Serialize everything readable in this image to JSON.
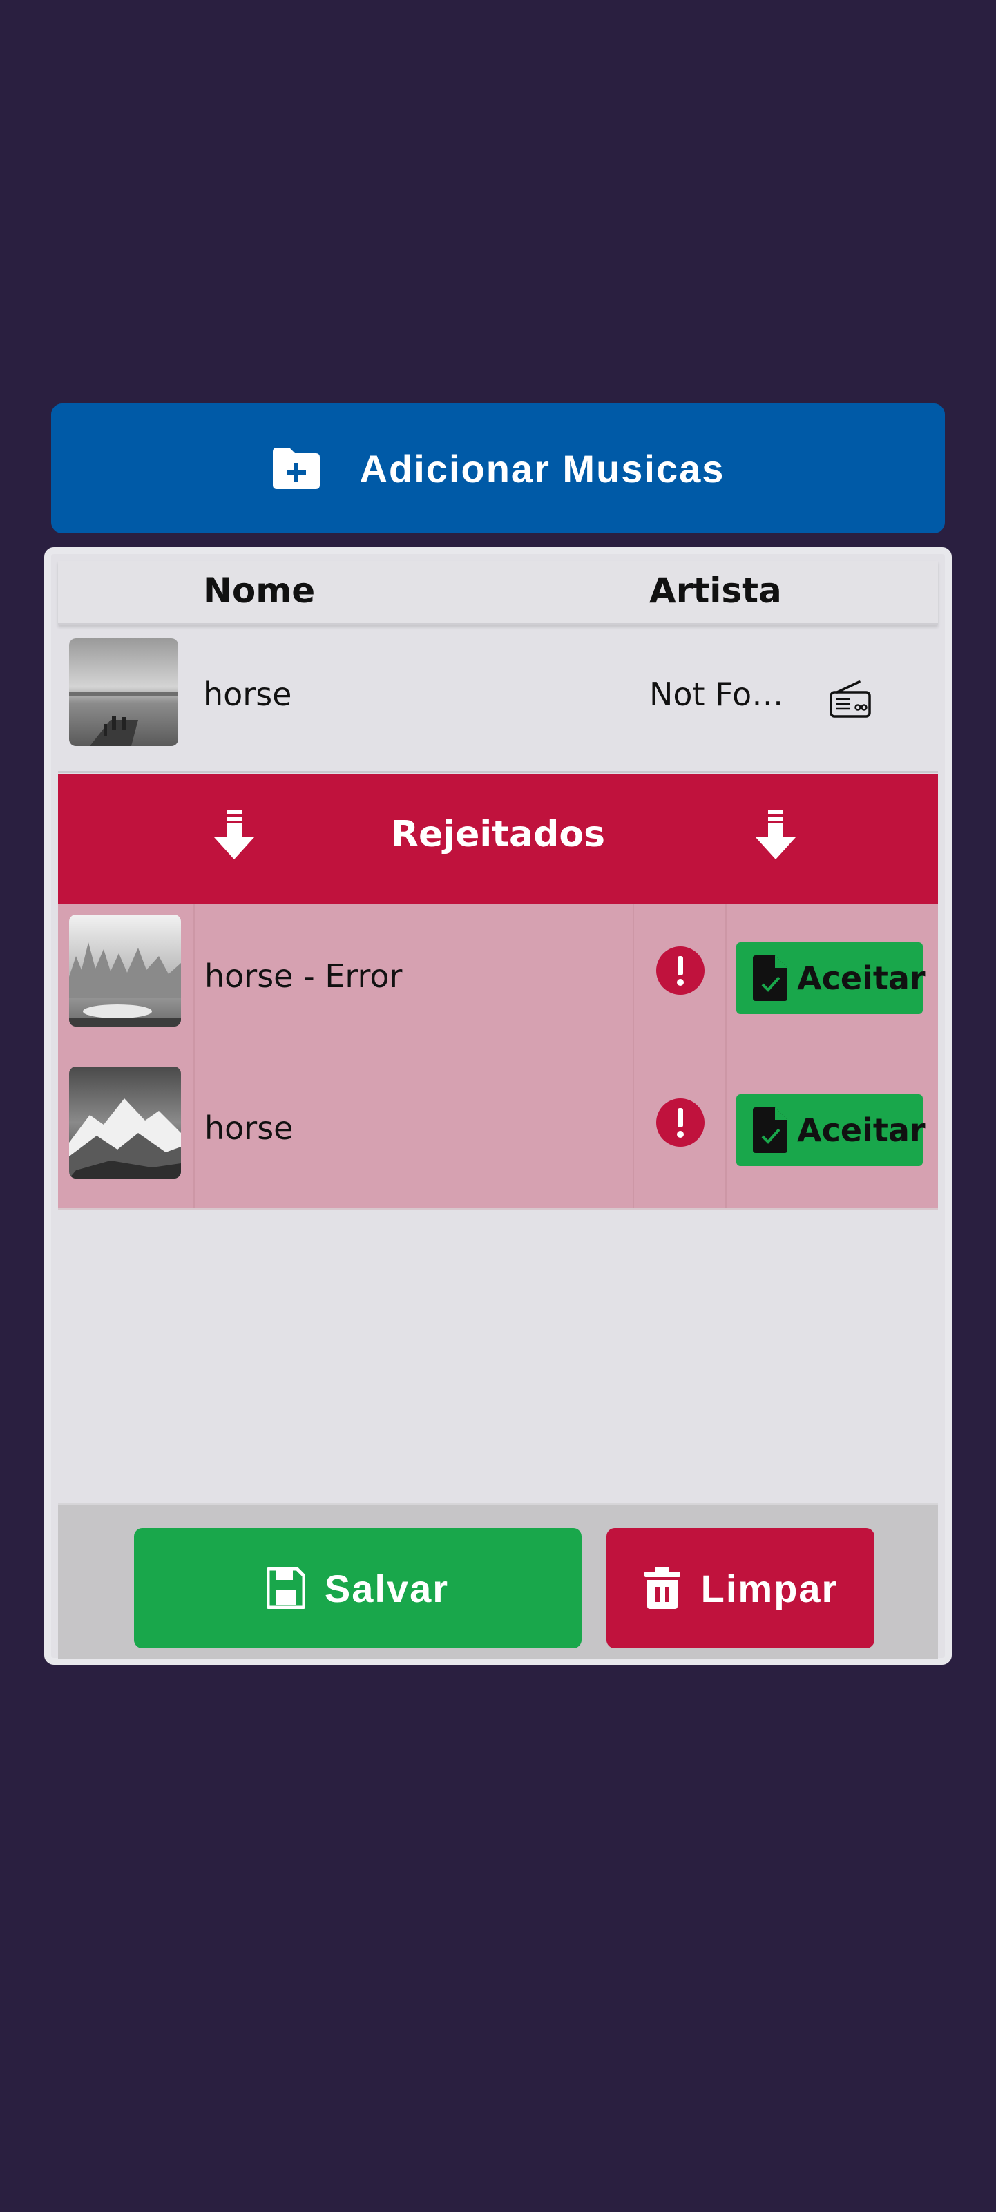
{
  "add_button": {
    "label": "Adicionar Musicas",
    "icon": "folder-plus-icon"
  },
  "table": {
    "columns": [
      "Nome",
      "Artista"
    ],
    "rows": [
      {
        "name": "horse",
        "artist": "Not Found",
        "thumbnail": "seascape-pier-photo",
        "icon": "radio-icon"
      }
    ]
  },
  "rejected": {
    "title": "Rejeitados",
    "icon": "arrow-down-icon",
    "rows": [
      {
        "name": "horse - Error",
        "thumbnail": "misty-skyline-lake-photo",
        "status_icon": "exclamation-icon",
        "accept_label": "Aceitar"
      },
      {
        "name": "horse",
        "thumbnail": "snowy-mountains-photo",
        "status_icon": "exclamation-icon",
        "accept_label": "Aceitar"
      }
    ]
  },
  "footer": {
    "save_label": "Salvar",
    "clear_label": "Limpar"
  },
  "colors": {
    "background": "#2a1f40",
    "primary_blue": "#005aa7",
    "reject_red": "#c0123d",
    "rejected_row": "#d6a1b1",
    "accept_green": "#19a74b"
  }
}
